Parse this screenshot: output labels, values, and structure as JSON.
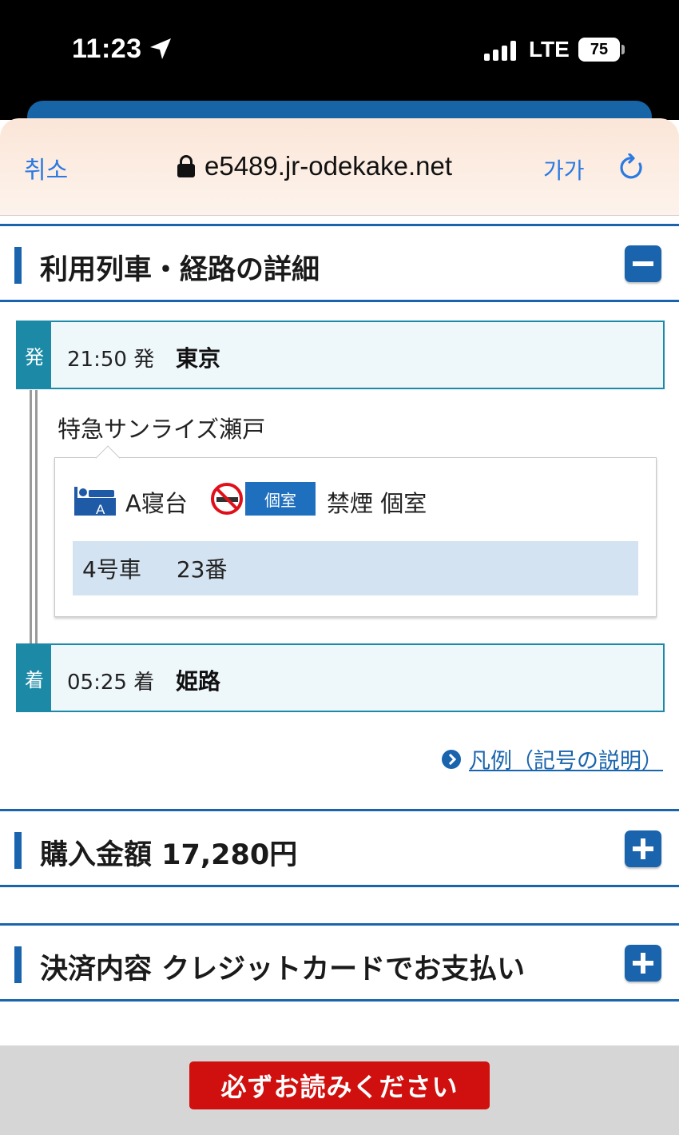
{
  "status_bar": {
    "time": "11:23",
    "network": "LTE",
    "battery": "75"
  },
  "browser": {
    "cancel_label": "취소",
    "url": "e5489.jr-odekake.net",
    "text_size_label": "가가"
  },
  "route_section": {
    "title": "利用列車・経路の詳細",
    "departure": {
      "tag": "発",
      "time": "21:50 発",
      "station": "東京"
    },
    "train": "特急サンライズ瀬戸",
    "car": {
      "icon": "bed-a-icon",
      "class": "A寝台",
      "nosmoke_icon": "no-smoking-icon",
      "badge": "個室",
      "room_type": "禁煙 個室",
      "car_number": "4号車",
      "seat_number": "23番"
    },
    "arrival": {
      "tag": "着",
      "time": "05:25 着",
      "station": "姫路"
    },
    "legend_link": "凡例（記号の説明）"
  },
  "price_section": {
    "title": "購入金額 17,280円"
  },
  "payment_section": {
    "title": "決済内容 クレジットカードでお支払い"
  },
  "notice_button": "必ずお読みください",
  "colors": {
    "accent": "#1a64ad",
    "station": "#1c8aa6",
    "notice": "#d0100f"
  }
}
